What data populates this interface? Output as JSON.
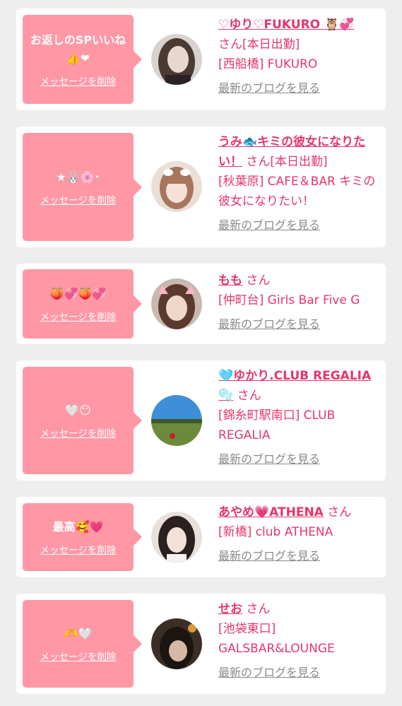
{
  "common": {
    "delete_label": "メッセージを削除",
    "blog_label": "最新のブログを見る",
    "san": "さん"
  },
  "cards": [
    {
      "message": "お返しのSPいいね",
      "message_emoji": "👍❤",
      "name": "♡ゆり♡FUKURO",
      "name_emoji": "🦉💞",
      "status": "[本日出勤]",
      "shop": "[西船橋] FUKURO",
      "avatar_icon": "avatar-woman-long-hair"
    },
    {
      "message": "★",
      "message_emoji": "🐰🌸･",
      "name": "うみ🐟キミの彼女になりたい！",
      "status": "[本日出勤]",
      "shop": "[秋葉原] CAFE＆BAR キミの彼女になりたい！",
      "avatar_icon": "avatar-girl-bangs"
    },
    {
      "message": "",
      "message_emoji": "🍑💞🍑💞",
      "name": "もも",
      "status": "",
      "shop": "[仲町台] Girls Bar Five G",
      "avatar_icon": "avatar-girl-cat-filter"
    },
    {
      "message": "",
      "message_emoji": "🤍😶",
      "name_emoji_before": "🩵",
      "name": "ゆかり.CLUB REGALIA",
      "name_emoji": "🫧",
      "status": "",
      "shop": "[錦糸町駅南口] CLUB REGALIA",
      "avatar_icon": "avatar-park-landscape"
    },
    {
      "message": "最高",
      "message_emoji": "🥰💗",
      "name": "あやめ💗ATHENA",
      "status": "",
      "shop": "[新橋] club ATHENA",
      "avatar_icon": "avatar-girl-dark-hair"
    },
    {
      "message": "",
      "message_emoji": "🫶🤍",
      "name": "せお",
      "status": "",
      "shop": "[池袋東口] GALSBAR&LOUNGE",
      "avatar_icon": "avatar-girl-dark-photo"
    }
  ],
  "colors": {
    "bubble": "#ff97a5",
    "accent": "#e5366b",
    "link_gray": "#8a8a8a",
    "background": "#eeeeee"
  }
}
